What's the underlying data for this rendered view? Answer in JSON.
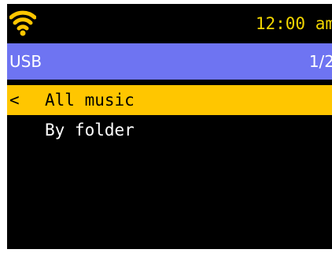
{
  "status_bar": {
    "wifi_icon": "wifi-icon",
    "time": "12:00 am"
  },
  "header": {
    "title": "USB",
    "page": "1/2"
  },
  "menu": {
    "items": [
      {
        "label": "All music",
        "indicator": "<",
        "selected": true
      },
      {
        "label": "By folder",
        "indicator": "",
        "selected": false
      }
    ]
  },
  "colors": {
    "background": "#000000",
    "clock": "#f2d600",
    "wifi": "#ffc600",
    "title_bar": "#6e74f2",
    "selection": "#ffc600",
    "text": "#ffffff"
  }
}
